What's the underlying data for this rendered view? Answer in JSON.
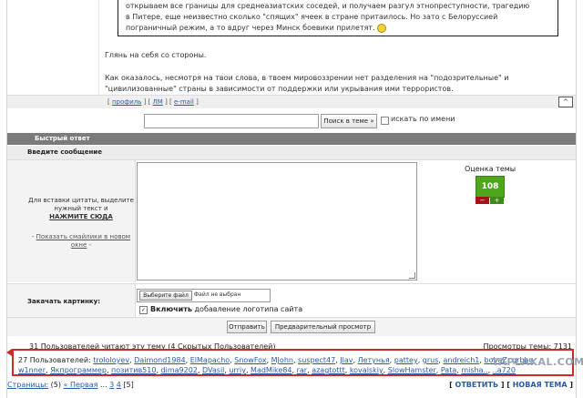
{
  "post": {
    "quote_lines": [
      "открываем все границы для среднеазиатских соседей, и получаем разгул этнопреступности, трагедию",
      "в Питере, еще неизвестно сколько \"спящих\" ячеек в стране притаилось. Но зато с Белоруссией",
      "пограничный режим, а то вдруг через Минск боевики прилетят."
    ],
    "text1": "Глянь на себя со стороны.",
    "text2_line1": "Как оказалось, несмотря на твои слова, в твоем мировоззрении нет разделения на \"подозрительные\" и",
    "text2_line2": "\"цивилизованные\" страны в зависимости от поддержки или укрывания ими террористов.",
    "link_profile": "профиль",
    "link_pm": "ЛМ",
    "link_email": "e-mail",
    "sep_open": "[ ",
    "sep_mid": " ] [ ",
    "sep_close": " ]",
    "up_button": "^"
  },
  "search": {
    "button": "Поиск в теме »",
    "checkbox_label": "искать по имени"
  },
  "quick_reply": {
    "header": "Быстрый ответ",
    "enter_message": "Введите сообщение",
    "hint_text": "Для вставки цитаты, выделите нужный текст и",
    "hint_bold": "НАЖМИТЕ СЮДА",
    "hint_link": "Показать смайлики в новом окне",
    "hint_dash": "- ",
    "hint_dash2": " -",
    "rating_label": "Оценка темы",
    "rating_value": "108",
    "rating_minus": "−",
    "rating_plus": "+"
  },
  "upload": {
    "label": "Закачать картинку:",
    "choose_button": "Выберите файл",
    "no_file": "Файл не выбран",
    "logo_bold": "Включить",
    "logo_rest": " добавление логотипа сайта",
    "logo_checked": "✓"
  },
  "submit": {
    "send": "Отправить",
    "preview": "Предварительный просмотр"
  },
  "readers": {
    "text": "31 Пользователей читают эту тему (4 Скрытых Пользователей)",
    "views": "Просмотры темы: 7131"
  },
  "users": {
    "prefix": "27 Пользователей: ",
    "line1": [
      "trololoyev",
      "Daimond1984",
      "ElMapacho",
      "SnowFox",
      "MJohn",
      "suspect47",
      "Jlav",
      "Летунья",
      "pattey",
      "grus",
      "andreich1",
      "bobaZ",
      "grbbu"
    ],
    "line2": [
      "w1nner",
      "Якпрограммер",
      "позитив510",
      "dima9202",
      "DVasil",
      "urriy",
      "MadMike84",
      "rar",
      "azagtottt",
      "kovalskiy",
      "SlowHamster",
      "Pata",
      "misha..",
      "..a720"
    ],
    "watermark": "YAPLAKAL.COM"
  },
  "pagination": {
    "label": "Страницы:",
    "count": " (5) ",
    "first": "« Первая",
    "dots": " ... ",
    "p3": "3",
    "p4": "4",
    "current": "[5]",
    "answer": "ОТВЕТИТЬ",
    "new_topic": "НОВАЯ ТЕМА"
  }
}
